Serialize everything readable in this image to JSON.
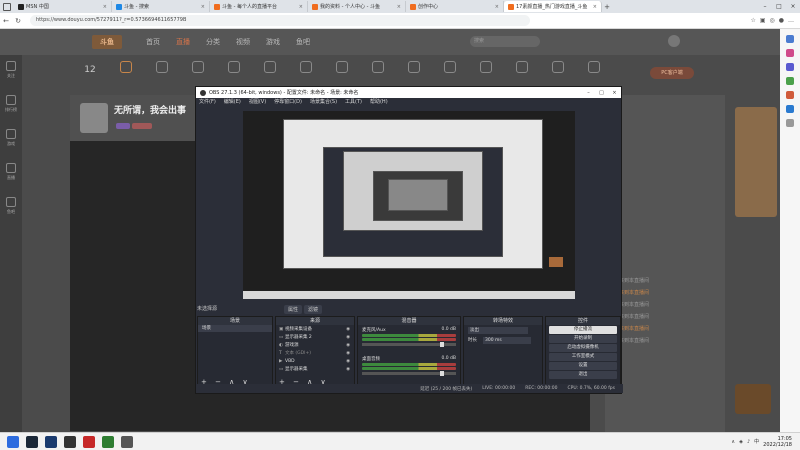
{
  "browser": {
    "tabs": [
      {
        "label": "MSN 中国",
        "color": "#222222"
      },
      {
        "label": "斗鱼 - 搜索",
        "color": "#1e88e5"
      },
      {
        "label": "斗鱼 - 每个人的直播平台",
        "color": "#f06d1f"
      },
      {
        "label": "我的资料 - 个人中心 - 斗鱼",
        "color": "#f06d1f"
      },
      {
        "label": "创作中心",
        "color": "#f06d1f"
      },
      {
        "label": "17素颜直播_热门游戏直播_斗鱼",
        "color": "#f06d1f",
        "active": true
      }
    ],
    "url": "https://www.douyu.com/5727911?_r=0.573669461165779B",
    "window_controls": [
      "–",
      "□",
      "×"
    ]
  },
  "site": {
    "logo": "斗鱼",
    "nav": [
      "首页",
      "直播",
      "分类",
      "视频",
      "游戏",
      "鱼吧"
    ],
    "nav_active_index": 1,
    "search_placeholder": "搜索",
    "date_number": "12",
    "pc_button": "PC客户端",
    "streamer_name": "无所谓，我会出事",
    "left_rail": [
      "关注",
      "排行榜",
      "游戏",
      "直播",
      "鱼吧"
    ],
    "chat_lines": [
      {
        "text": "欢迎来到本直播间",
        "hi": false
      },
      {
        "text": "欢迎来到本直播间",
        "hi": true
      },
      {
        "text": "欢迎来到本直播间",
        "hi": false
      },
      {
        "text": "欢迎来到本直播间",
        "hi": false
      },
      {
        "text": "欢迎来到本直播间",
        "hi": true
      },
      {
        "text": "欢迎来到本直播间",
        "hi": false
      }
    ]
  },
  "obs": {
    "title": "OBS 27.1.3 (64-bit, windows) - 配置文件: 未命名 - 场景: 未命名",
    "menu": [
      "文件(F)",
      "编辑(E)",
      "视图(V)",
      "停靠窗口(D)",
      "场景集合(S)",
      "工具(T)",
      "帮助(H)"
    ],
    "source_label": "未选择源",
    "mid_tabs": [
      "属性",
      "滤镜"
    ],
    "docks": {
      "scenes": {
        "title": "场景",
        "items": [
          "场景"
        ]
      },
      "sources": {
        "title": "来源",
        "items": [
          {
            "icon": "▣",
            "name": "视频采集设备"
          },
          {
            "icon": "▭",
            "name": "显示器采集 2"
          },
          {
            "icon": "◐",
            "name": "游戏源"
          },
          {
            "icon": "T",
            "name": "文本 (GDI+)"
          },
          {
            "icon": "▶",
            "name": "VBD"
          },
          {
            "icon": "▭",
            "name": "显示器采集"
          }
        ]
      },
      "mixer": {
        "title": "混音器",
        "channels": [
          {
            "name": "麦克风/Aux",
            "db": "0.0 dB"
          },
          {
            "name": "桌面音频",
            "db": "0.0 dB"
          }
        ]
      },
      "transitions": {
        "title": "转场特效",
        "type": "淡出",
        "duration_label": "时长",
        "duration": "300 ms"
      },
      "controls": {
        "title": "控件",
        "buttons": [
          "停止播流",
          "开始录制",
          "启动虚拟摄像机",
          "工作室模式",
          "设置",
          "退出"
        ],
        "selected_index": 0
      }
    },
    "status": {
      "live": "LIVE: 00:00:00",
      "rec": "REC: 00:00:00",
      "cpu": "CPU: 0.7%, 60.00 fps",
      "dropped": "延迟 (25 / 200 帧已丢失)"
    },
    "footer_controls": "+ − ∧ ∨"
  },
  "taskbar": {
    "time": "17:05",
    "date": "2022/12/18",
    "ime": "中",
    "app_colors": [
      "#2d6cdf",
      "#1b2838",
      "#1a3a6e",
      "#333333",
      "#c62828",
      "#2e7d32",
      "#555555"
    ]
  }
}
